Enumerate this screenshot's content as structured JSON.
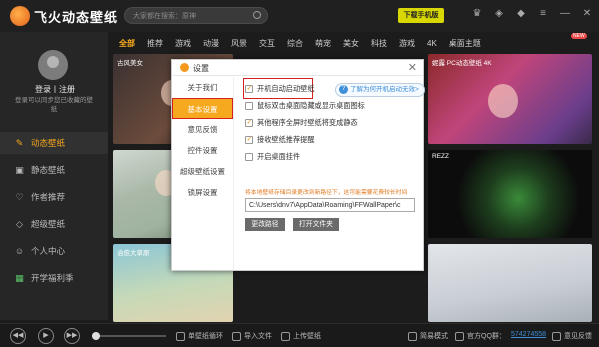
{
  "app": {
    "title": "飞火动态壁纸",
    "search_placeholder": "大家都在搜索：原神",
    "download_label": "下载手机版"
  },
  "categories": [
    "全部",
    "推荐",
    "游戏",
    "动漫",
    "风景",
    "交互",
    "综合",
    "萌宠",
    "美女",
    "科技",
    "游戏",
    "4K",
    "桌面主题"
  ],
  "categories_active": "全部",
  "new_tag": "NEW",
  "cat_right": [
    "在线预览",
    "最新壁纸"
  ],
  "sidebar": {
    "login": "登录丨注册",
    "login_sub": "登录可以同步您已收藏的壁纸",
    "items": [
      {
        "label": "动态壁纸",
        "icon": "palette-icon",
        "active": true
      },
      {
        "label": "静态壁纸",
        "icon": "image-icon",
        "active": false
      },
      {
        "label": "作者推荐",
        "icon": "heart-icon",
        "active": false
      },
      {
        "label": "超级壁纸",
        "icon": "gem-icon",
        "active": false
      },
      {
        "label": "个人中心",
        "icon": "user-icon",
        "active": false
      },
      {
        "label": "开学福利季",
        "icon": "gift-icon",
        "active": false
      }
    ]
  },
  "thumbs": [
    {
      "label": "古风美女"
    },
    {
      "label": "妮露 PC动态壁纸 4K"
    },
    {
      "label": ""
    },
    {
      "label": "REZZ"
    },
    {
      "label": "治愈大草原"
    },
    {
      "label": ""
    }
  ],
  "bottom": {
    "items": [
      {
        "label": "单壁纸循环",
        "icon": "loop-icon"
      },
      {
        "label": "导入文件",
        "icon": "import-icon"
      },
      {
        "label": "上传壁纸",
        "icon": "upload-icon"
      },
      {
        "label": "简易模式",
        "icon": "mode-icon"
      },
      {
        "label": "官方QQ群：",
        "icon": "qq-icon"
      },
      {
        "label": "574274558",
        "icon": ""
      },
      {
        "label": "意见反馈",
        "icon": "feedback-icon"
      }
    ]
  },
  "dialog": {
    "title": "设置",
    "nav": [
      "关于我们",
      "基本设置",
      "意见反馈",
      "控件设置",
      "超级壁纸设置",
      "锁屏设置"
    ],
    "nav_active": "基本设置",
    "options": [
      {
        "label": "开机自动启动壁纸",
        "checked": true
      },
      {
        "label": "鼠标双击桌面隐藏或显示桌面图标",
        "checked": false
      },
      {
        "label": "其他程序全屏时壁纸将变成静态",
        "checked": true
      },
      {
        "label": "接收壁纸推荐提醒",
        "checked": true
      },
      {
        "label": "开启桌面挂件",
        "checked": false
      }
    ],
    "help_link": "了解为何开机启动无效>",
    "path_note": "将本地壁纸存储目录更改到新路径下，这可能需要花费较长时间",
    "path_value": "C:\\Users\\dnv7\\AppData\\Roaming\\FFWallPaper\\c",
    "btn_change": "更改路径",
    "btn_open": "打开文件夹"
  }
}
